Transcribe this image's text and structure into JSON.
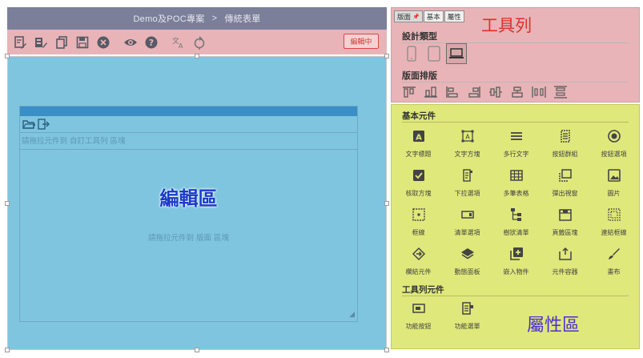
{
  "header": {
    "project": "Demo及POC專案",
    "separator": ">",
    "page": "傳統表單"
  },
  "toolbar": {
    "icons": [
      "edit-form-icon",
      "batch-edit-icon",
      "copy-icon",
      "save-icon",
      "close-circle-icon",
      "preview-eye-icon",
      "help-icon",
      "translate-icon",
      "refresh-icon"
    ],
    "edit_status": "編輯中"
  },
  "editor": {
    "drop_hint_toolbar": "請拖拉元件到 自訂工具列 區塊",
    "area_label": "編輯區",
    "drop_hint_layout": "請拖拉元件到 版面 區塊"
  },
  "tool_panel": {
    "tabs": [
      {
        "label": "版面",
        "pin": "📌"
      },
      {
        "label": "基本"
      },
      {
        "label": "屬性"
      }
    ],
    "title": "工具列",
    "design_type_heading": "設計類型",
    "layout_heading": "版面排版",
    "devices": [
      "phone-icon",
      "tablet-icon",
      "desktop-icon"
    ],
    "selected_device": "desktop-icon"
  },
  "components": {
    "basic_heading": "基本元件",
    "items": [
      {
        "label": "文字標題",
        "icon": "text-title-icon"
      },
      {
        "label": "文字方塊",
        "icon": "text-box-icon"
      },
      {
        "label": "多行文字",
        "icon": "multiline-text-icon"
      },
      {
        "label": "按鈕群組",
        "icon": "button-group-icon"
      },
      {
        "label": "按鈕選項",
        "icon": "radio-button-icon"
      },
      {
        "label": "核取方塊",
        "icon": "checkbox-icon"
      },
      {
        "label": "下拉選項",
        "icon": "dropdown-icon"
      },
      {
        "label": "多筆表格",
        "icon": "grid-table-icon"
      },
      {
        "label": "彈出視窗",
        "icon": "popup-window-icon"
      },
      {
        "label": "圖片",
        "icon": "image-icon"
      },
      {
        "label": "框線",
        "icon": "border-frame-icon"
      },
      {
        "label": "清單選項",
        "icon": "list-option-icon"
      },
      {
        "label": "樹狀清單",
        "icon": "tree-list-icon"
      },
      {
        "label": "頁籤區塊",
        "icon": "tab-block-icon"
      },
      {
        "label": "連結框線",
        "icon": "linked-frame-icon"
      },
      {
        "label": "欄結元件",
        "icon": "column-link-icon"
      },
      {
        "label": "動態面板",
        "icon": "layers-icon"
      },
      {
        "label": "嵌入物件",
        "icon": "embed-object-icon"
      },
      {
        "label": "元件容器",
        "icon": "component-container-icon"
      },
      {
        "label": "畫布",
        "icon": "brush-canvas-icon"
      }
    ],
    "toolbar_heading": "工具列元件",
    "toolbar_items": [
      {
        "label": "功能按鈕",
        "icon": "function-button-icon"
      },
      {
        "label": "功能選單",
        "icon": "function-menu-icon"
      }
    ],
    "area_label": "屬性區"
  },
  "colors": {
    "header_bg": "#7b7f99",
    "toolbar_bg": "#e8b4b8",
    "editor_bg": "#7fc5e0",
    "component_bg": "#dfe87a",
    "edit_status": "#d93a3a",
    "tool_title": "#e0302a",
    "editor_label": "#1a3ac9",
    "property_label": "#4a2fcf"
  }
}
